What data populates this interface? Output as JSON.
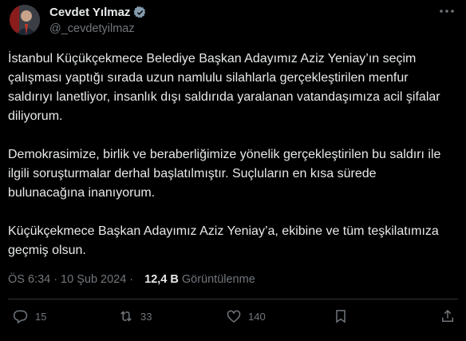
{
  "author": {
    "name": "Cevdet Yılmaz",
    "handle": "@_cevdetyilmaz"
  },
  "paragraphs": [
    "İstanbul Küçükçekmece Belediye Başkan Adayımız Aziz Yeniay’ın seçim çalışması yaptığı sırada uzun namlulu silahlarla gerçekleştirilen menfur saldırıyı lanetliyor, insanlık dışı saldırıda yaralanan vatandaşımıza acil şifalar diliyorum.",
    "Demokrasimize, birlik ve beraberliğimize yönelik gerçekleştirilen bu saldırı ile ilgili soruşturmalar derhal başlatılmıştır. Suçluların en kısa sürede bulunacağına inanıyorum.",
    "Küçükçekmece Başkan Adayımız Aziz Yeniay’a, ekibine ve tüm teşkilatımıza geçmiş olsun."
  ],
  "meta": {
    "time": "ÖS 6:34",
    "separator": "·",
    "date": "10 Şub 2024",
    "views_count": "12,4 B",
    "views_label": "Görüntülenme"
  },
  "actions": {
    "replies": "15",
    "reposts": "33",
    "likes": "140"
  },
  "colors": {
    "background": "#000000",
    "text": "#e7e9ea",
    "muted": "#71767b",
    "verified": "#829aab"
  }
}
